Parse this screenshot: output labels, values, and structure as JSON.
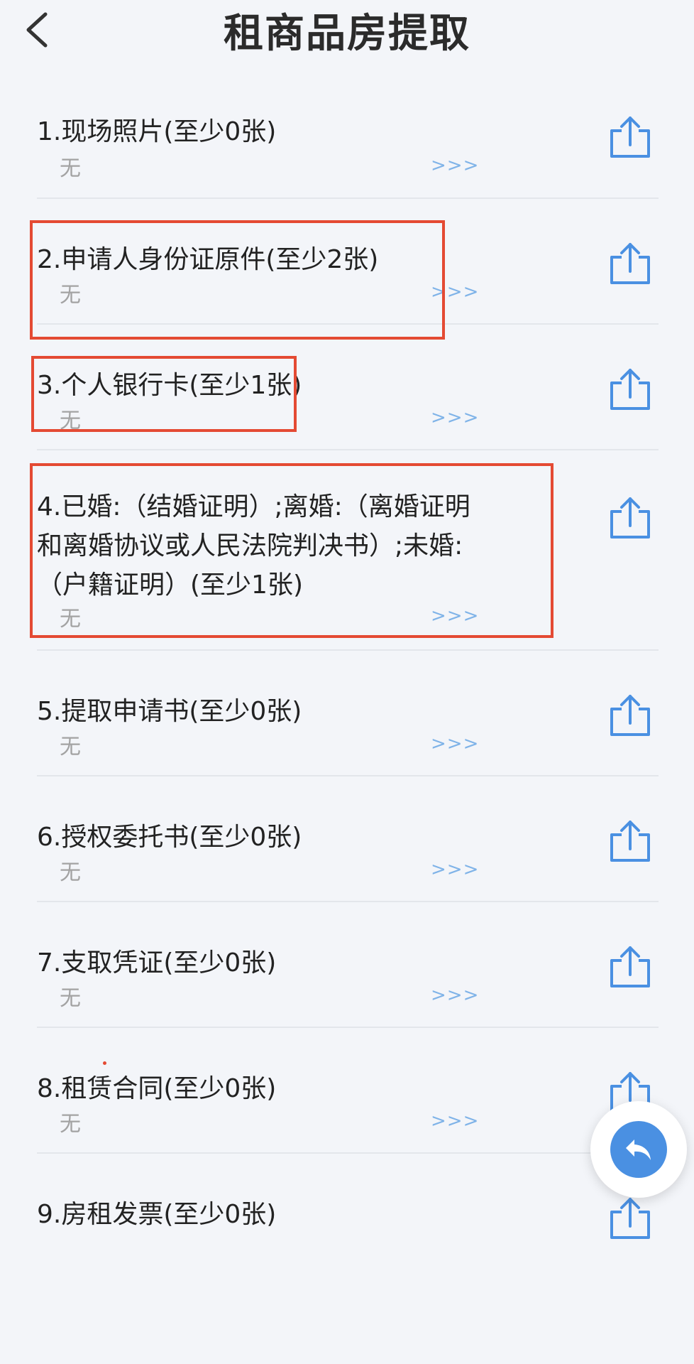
{
  "header": {
    "title": "租商品房提取",
    "back_icon": "chevron-left-icon"
  },
  "items": [
    {
      "title": "1.现场照片(至少0张)",
      "value": "无",
      "more": ">>>"
    },
    {
      "title": "2.申请人身份证原件(至少2张)",
      "value": "无",
      "more": ">>>"
    },
    {
      "title": "3.个人银行卡(至少1张)",
      "value": "无",
      "more": ">>>"
    },
    {
      "title": "4.已婚:（结婚证明）;离婚:（离婚证明\n和离婚协议或人民法院判决书）;未婚:\n（户籍证明）(至少1张)",
      "value": "无",
      "more": ">>>"
    },
    {
      "title": "5.提取申请书(至少0张)",
      "value": "无",
      "more": ">>>"
    },
    {
      "title": "6.授权委托书(至少0张)",
      "value": "无",
      "more": ">>>"
    },
    {
      "title": "7.支取凭证(至少0张)",
      "value": "无",
      "more": ">>>"
    },
    {
      "title": "8.租赁合同(至少0张)",
      "value": "无",
      "more": ">>>"
    },
    {
      "title": "9.房租发票(至少0张)"
    }
  ],
  "upload_icon": "upload-icon",
  "fab": {
    "icon": "undo-arrow-icon"
  },
  "colors": {
    "accent": "#4a90e2",
    "highlight": "#e44a33",
    "muted": "#a3a3a3",
    "link": "#7fb3e8"
  }
}
